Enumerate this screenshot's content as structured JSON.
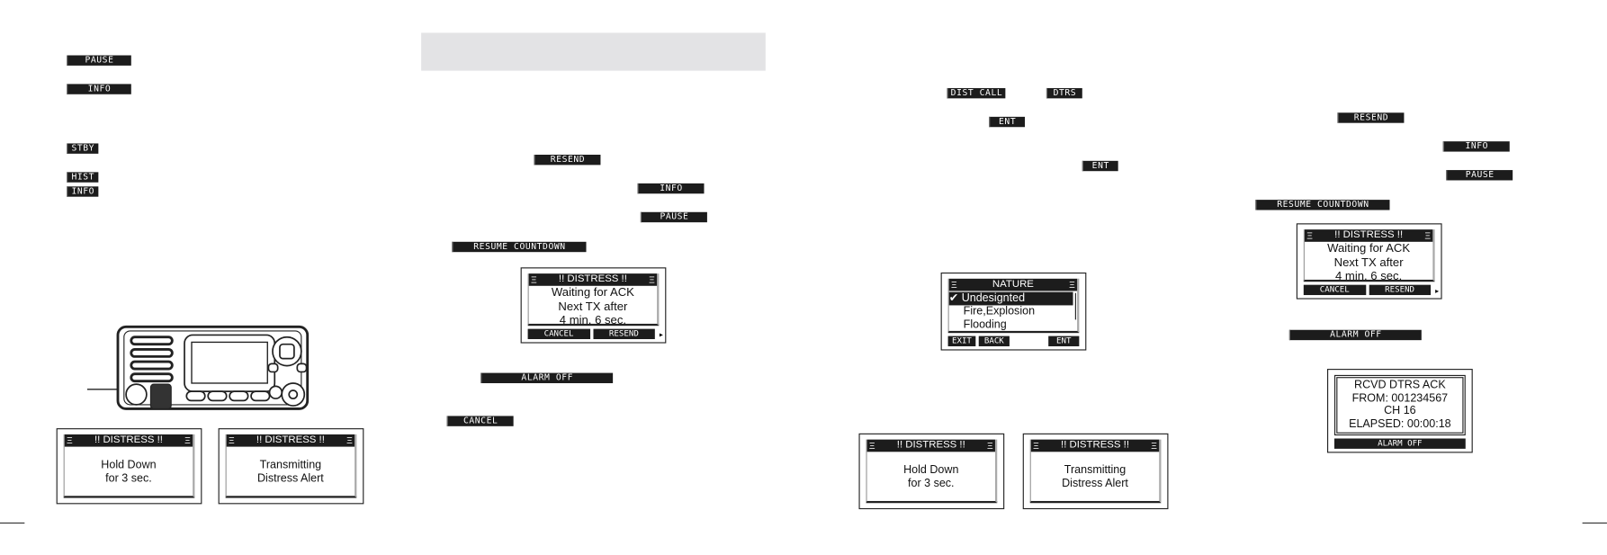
{
  "left_page": {
    "keys": {
      "pause": "PAUSE",
      "info": "INFO",
      "stby": "STBY",
      "hist": "HIST",
      "info_small": "INFO"
    },
    "screen_hold": {
      "title": "!! DISTRESS !!",
      "line1": "Hold Down",
      "line2": "for 3 sec."
    },
    "screen_tx": {
      "title": "!! DISTRESS !!",
      "line1": "Transmitting",
      "line2": "Distress Alert"
    }
  },
  "middle_page": {
    "keys": {
      "resend": "RESEND",
      "info": "INFO",
      "pause": "PAUSE",
      "resume": "RESUME COUNTDOWN",
      "alarm_off": "ALARM OFF",
      "cancel": "CANCEL"
    },
    "screen_wait": {
      "title": "!! DISTRESS !!",
      "line1": "Waiting for ACK",
      "line2": "Next TX after",
      "line3": "4 min. 6 sec.",
      "soft_left": "CANCEL",
      "soft_right": "RESEND"
    }
  },
  "right_page": {
    "keys": {
      "dist_call": "DIST CALL",
      "dtrs": "DTRS",
      "ent1": "ENT",
      "ent2": "ENT"
    },
    "nature_screen": {
      "title": "NATURE",
      "items": [
        "Undesignted",
        "Fire,Explosion",
        "Flooding"
      ],
      "selected": "Undesignted",
      "soft": [
        "EXIT",
        "BACK",
        "ENT"
      ]
    },
    "screen_hold": {
      "title": "!! DISTRESS !!",
      "line1": "Hold Down",
      "line2": "for 3 sec."
    },
    "screen_tx": {
      "title": "!! DISTRESS !!",
      "line1": "Transmitting",
      "line2": "Distress Alert"
    }
  },
  "far_right_page": {
    "keys": {
      "resend": "RESEND",
      "info": "INFO",
      "pause": "PAUSE",
      "resume": "RESUME COUNTDOWN",
      "alarm_off": "ALARM OFF"
    },
    "screen_wait": {
      "title": "!! DISTRESS !!",
      "line1": "Waiting for ACK",
      "line2": "Next TX after",
      "line3": "4 min. 6 sec.",
      "soft_left": "CANCEL",
      "soft_right": "RESEND"
    },
    "ack_screen": {
      "line1": "RCVD DTRS ACK",
      "line2": "FROM: 001234567",
      "line3": "CH 16",
      "line4": "ELAPSED: 00:00:18",
      "soft": "ALARM OFF"
    }
  },
  "colors": {
    "key_bg": "#1c1c1c",
    "banner_bg": "#e3e3e5"
  }
}
